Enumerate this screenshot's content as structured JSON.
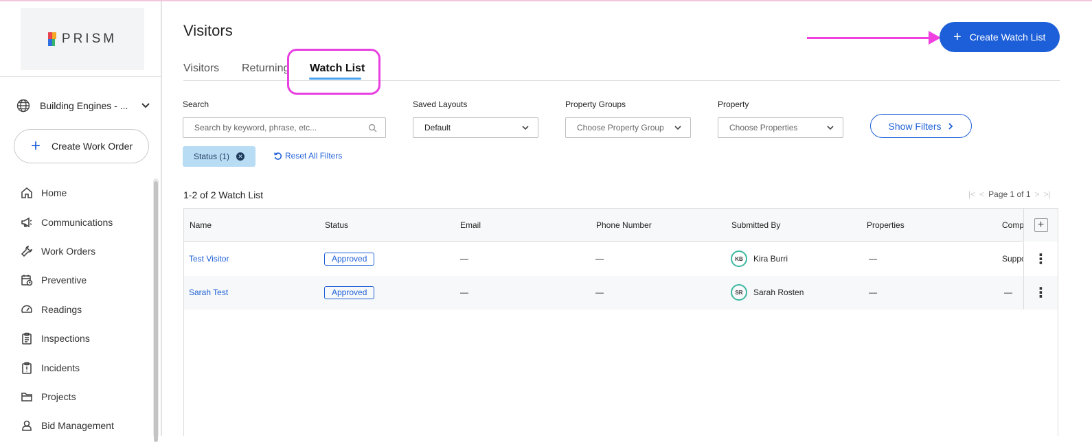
{
  "brand": {
    "logo_text": "PRISM"
  },
  "sidebar": {
    "org_name": "Building Engines - ...",
    "create_button": "Create Work Order",
    "items": [
      {
        "label": "Home",
        "icon": "home-icon"
      },
      {
        "label": "Communications",
        "icon": "megaphone-icon"
      },
      {
        "label": "Work Orders",
        "icon": "wrench-icon"
      },
      {
        "label": "Preventive",
        "icon": "calendar-clock-icon"
      },
      {
        "label": "Readings",
        "icon": "gauge-icon"
      },
      {
        "label": "Inspections",
        "icon": "clipboard-icon"
      },
      {
        "label": "Incidents",
        "icon": "alert-clipboard-icon"
      },
      {
        "label": "Projects",
        "icon": "folder-icon"
      },
      {
        "label": "Bid Management",
        "icon": "person-badge-icon"
      }
    ]
  },
  "page": {
    "title": "Visitors"
  },
  "tabs": [
    {
      "label": "Visitors"
    },
    {
      "label": "Returning"
    },
    {
      "label": "Watch List",
      "active": true
    }
  ],
  "actions": {
    "create_watch_list": "Create Watch List"
  },
  "filters": {
    "search_label": "Search",
    "search_placeholder": "Search by keyword, phrase, etc...",
    "saved_layouts_label": "Saved Layouts",
    "saved_layouts_value": "Default",
    "property_groups_label": "Property Groups",
    "property_groups_value": "Choose Property Group",
    "property_label": "Property",
    "property_value": "Choose Properties",
    "show_filters": "Show Filters",
    "status_chip": "Status (1)",
    "reset": "Reset All Filters"
  },
  "results": {
    "count_text": "1-2 of 2 Watch List",
    "page_text": "Page 1 of 1"
  },
  "table": {
    "columns": [
      "Name",
      "Status",
      "Email",
      "Phone Number",
      "Submitted By",
      "Properties",
      "Comp"
    ],
    "rows": [
      {
        "name": "Test Visitor",
        "status": "Approved",
        "email": "—",
        "phone": "—",
        "initials": "KB",
        "submitted_by": "Kira Burri",
        "properties": "—",
        "comp": "Suppo"
      },
      {
        "name": "Sarah Test",
        "status": "Approved",
        "email": "—",
        "phone": "—",
        "initials": "SR",
        "submitted_by": "Sarah Rosten",
        "properties": "—",
        "comp": "—"
      }
    ]
  },
  "colors": {
    "accent": "#1d5fd8",
    "annotation": "#f040e0",
    "chip_bg": "#b9dcf5",
    "avatar_ring": "#3bb8a0"
  }
}
